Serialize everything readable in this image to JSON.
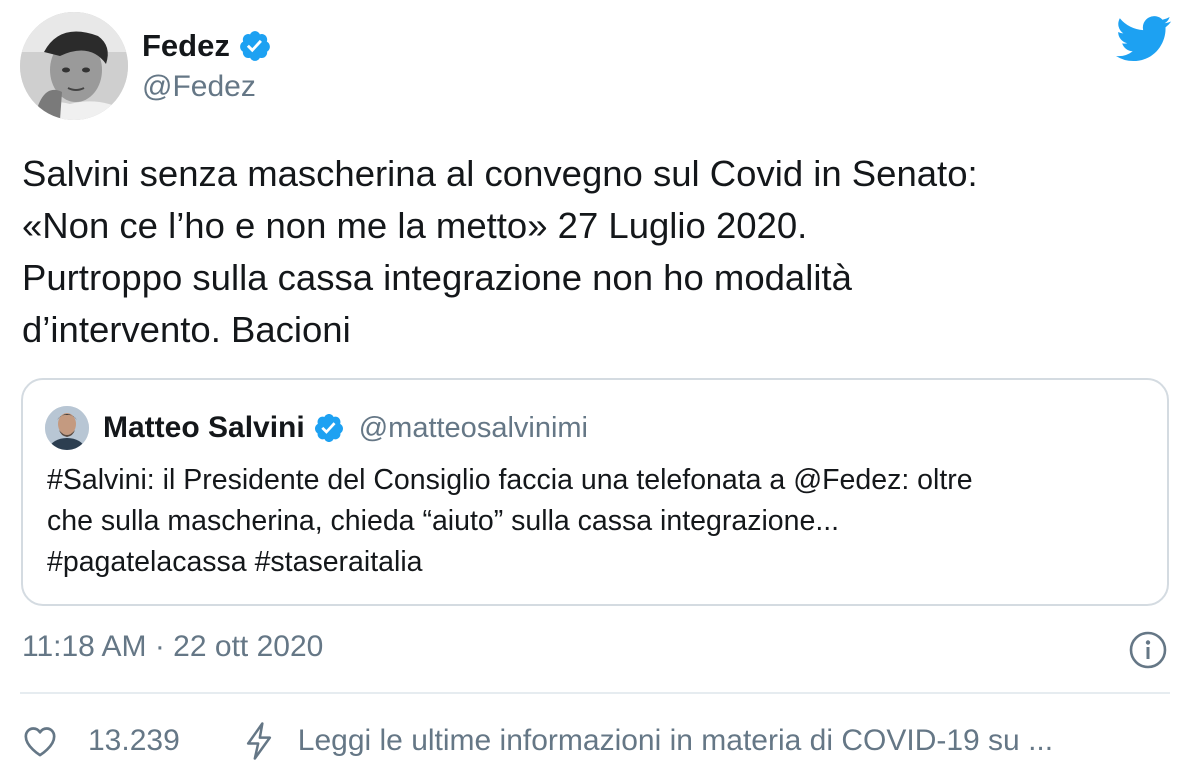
{
  "author": {
    "display_name": "Fedez",
    "handle": "@Fedez",
    "verified": true,
    "avatar_icon": "user-avatar-photo"
  },
  "tweet": {
    "lines": [
      "Salvini senza mascherina al convegno sul Covid in Senato:",
      "«Non ce l’ho e non me la metto» 27 Luglio 2020.",
      "Purtroppo sulla cassa integrazione non ho modalità",
      "d’intervento. Bacioni"
    ]
  },
  "quoted_tweet": {
    "display_name": "Matteo Salvini",
    "handle": "@matteosalvinimi",
    "verified": true,
    "lines": [
      "#Salvini: il Presidente del Consiglio faccia una telefonata a @Fedez: oltre",
      "che sulla mascherina, chieda “aiuto” sulla cassa integrazione...",
      "#pagatelacassa #staseraitalia"
    ]
  },
  "meta": {
    "timestamp": "11:18 AM · 22 ott 2020"
  },
  "actions": {
    "like_count": "13.239",
    "covid_link": "Leggi le ultime informazioni in materia di COVID-19 su ..."
  },
  "colors": {
    "brand_blue": "#1da1f2",
    "text_primary": "#14171a",
    "text_secondary": "#657786",
    "border": "#d4dbe1"
  },
  "icons": {
    "brand": "twitter-bird-icon",
    "verified": "verified-badge-icon",
    "info": "info-icon",
    "like": "heart-icon",
    "covid": "lightning-bolt-icon"
  }
}
